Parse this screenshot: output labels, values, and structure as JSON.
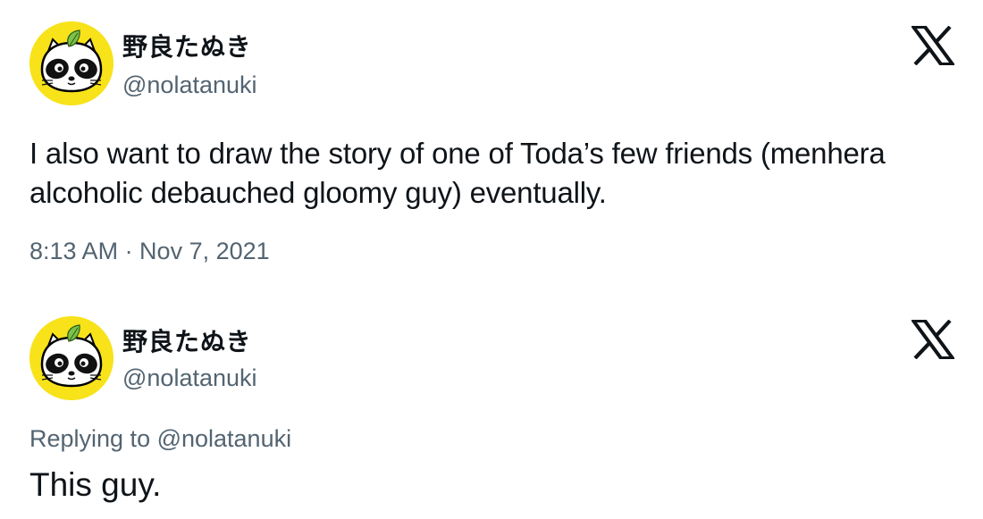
{
  "tweets": [
    {
      "display_name": "野良たぬき",
      "handle": "@nolatanuki",
      "text": "I also want to draw the story of one of Toda’s few friends (menhera alcoholic debauched gloomy guy) eventually.",
      "timestamp": "8:13 AM · Nov 7, 2021",
      "avatar_icon": "tanuki-avatar-icon",
      "platform_icon": "x-logo-icon"
    },
    {
      "display_name": "野良たぬき",
      "handle": "@nolatanuki",
      "replying_to": "Replying to @nolatanuki",
      "text": "This guy.",
      "avatar_icon": "tanuki-avatar-icon",
      "platform_icon": "x-logo-icon"
    }
  ],
  "colors": {
    "avatar_bg": "#f8e21a",
    "text": "#0f1419",
    "secondary_text": "#536471",
    "leaf": "#7cc24a"
  }
}
